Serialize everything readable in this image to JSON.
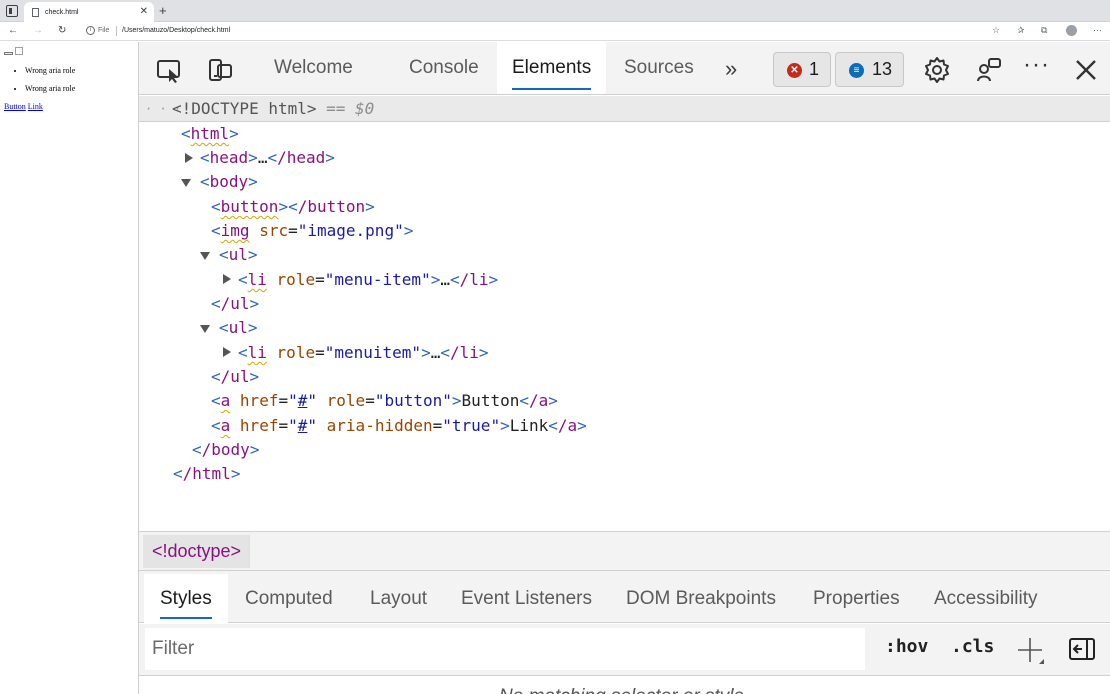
{
  "browser": {
    "tab_title": "check.html",
    "tab_close": "✕",
    "new_tab": "+",
    "file_label": "File",
    "url": "/Users/matuzo/Desktop/check.html"
  },
  "page": {
    "list1": [
      "Wrong aria role"
    ],
    "list2": [
      "Wrong aria role"
    ],
    "button_link_text": "Button",
    "link_text": "Link"
  },
  "devtools": {
    "tabs": {
      "welcome": "Welcome",
      "console": "Console",
      "elements": "Elements",
      "sources": "Sources"
    },
    "more_tabs_label": "»",
    "errors_count": "1",
    "issues_count": "13",
    "doctype_line": {
      "dots": "· · ·",
      "text": "<!DOCTYPE html>",
      "eq": "==",
      "selected": "$0"
    },
    "tree": {
      "html_open_tag": "html",
      "head_tag": "head",
      "head_close": "/head",
      "ellipsis": "…",
      "body_tag": "body",
      "button_tag": "button",
      "button_close": "/button",
      "img_tag": "img",
      "img_attr": "src",
      "img_value": "image.png",
      "ul_tag": "ul",
      "ul_close": "/ul",
      "li_tag": "li",
      "li_close": "/li",
      "role_attr": "role",
      "li1_role": "menu-item",
      "li2_role": "menuitem",
      "a_tag": "a",
      "a_close": "/a",
      "href_attr": "href",
      "href_value": "#",
      "a1_role": "button",
      "a1_text": "Button",
      "aria_hidden_attr": "aria-hidden",
      "aria_hidden_value": "true",
      "a2_text": "Link",
      "body_close": "/body",
      "html_close": "/html"
    },
    "breadcrumb": "<!doctype>",
    "sub_tabs": [
      "Styles",
      "Computed",
      "Layout",
      "Event Listeners",
      "DOM Breakpoints",
      "Properties",
      "Accessibility"
    ],
    "filter_placeholder": "Filter",
    "hov": ":hov",
    "cls": ".cls",
    "styles_empty_message": "No matching selector or style"
  },
  "colors": {
    "accent": "#0f6cbd",
    "tag": "#881280",
    "bracket": "#3065b8",
    "attr_name": "#994500",
    "attr_value": "#1a1aa6",
    "error": "#c42b1c",
    "info": "#0f6cbd",
    "warning_squiggle": "#d6a600"
  }
}
